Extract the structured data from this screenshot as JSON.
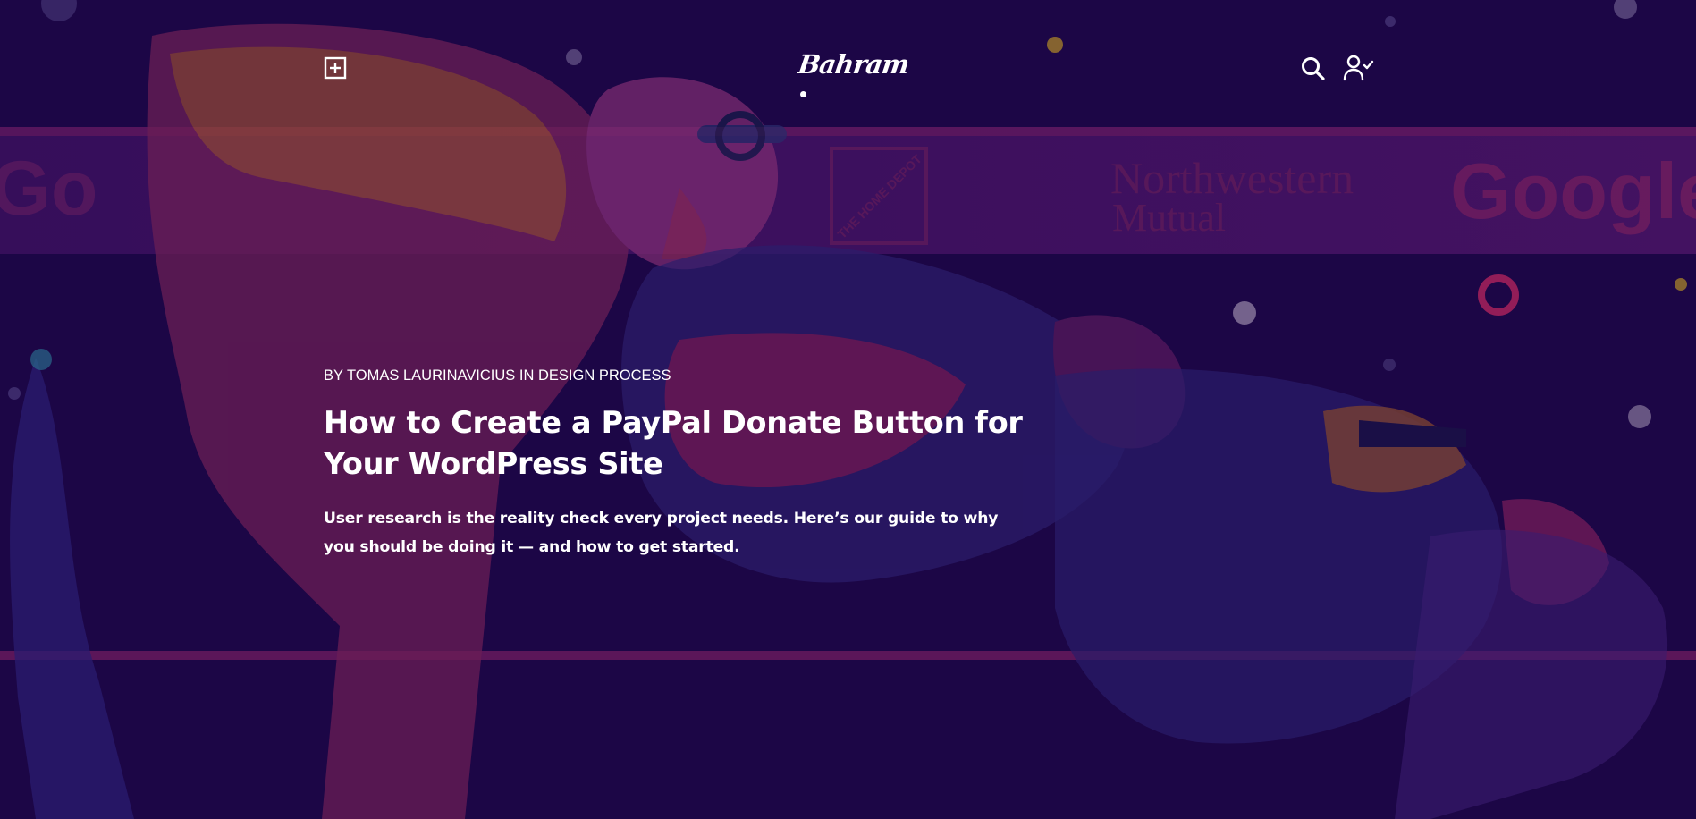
{
  "header": {
    "logo_text": "Bahram",
    "menu_icon": "plus-square-icon",
    "search_icon": "search-icon",
    "account_icon": "user-check-icon"
  },
  "background": {
    "sponsor_logos": [
      "Go",
      "THE HOME DEPOT",
      "Northwestern",
      "Mutual",
      "Google"
    ]
  },
  "post": {
    "meta": {
      "by": "BY",
      "author": "TOMAS LAURINAVICIUS",
      "in": "IN",
      "category": "DESIGN PROCESS"
    },
    "title": "How to Create a PayPal Donate Button for Your WordPress Site",
    "excerpt": "User research is the reality check every project needs. Here’s our guide to why you should be doing it — and how to get started."
  },
  "colors": {
    "background": "#1c0646",
    "accent_magenta": "#8b1a6b",
    "accent_orange": "#c8832a",
    "text": "#ffffff"
  }
}
